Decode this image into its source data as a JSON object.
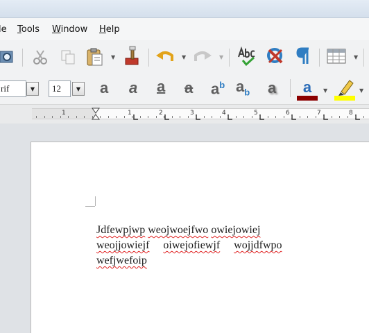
{
  "menubar": {
    "items": [
      {
        "pre": "",
        "acc": "",
        "post": "le"
      },
      {
        "pre": "",
        "acc": "T",
        "post": "ools"
      },
      {
        "pre": "",
        "acc": "W",
        "post": "indow"
      },
      {
        "pre": "",
        "acc": "H",
        "post": "elp"
      }
    ]
  },
  "toolbar_formatting": {
    "font_name": "rif",
    "font_size": "12"
  },
  "ruler": {
    "numbers": [
      "1",
      "1",
      "2",
      "3",
      "4",
      "5",
      "6",
      "7",
      "8"
    ]
  },
  "document": {
    "lines": [
      [
        "Jdfewpjwp",
        "weojwoejfwo",
        "owiejowiej"
      ],
      [
        "weojjowiejf",
        "oiwejofiewjf",
        "wojjdfwpo"
      ],
      [
        "wefjwefoip"
      ]
    ]
  },
  "colors": {
    "font_color": "#8b0000",
    "highlight_color": "#ffff00",
    "spell_underline": "#e02020"
  }
}
